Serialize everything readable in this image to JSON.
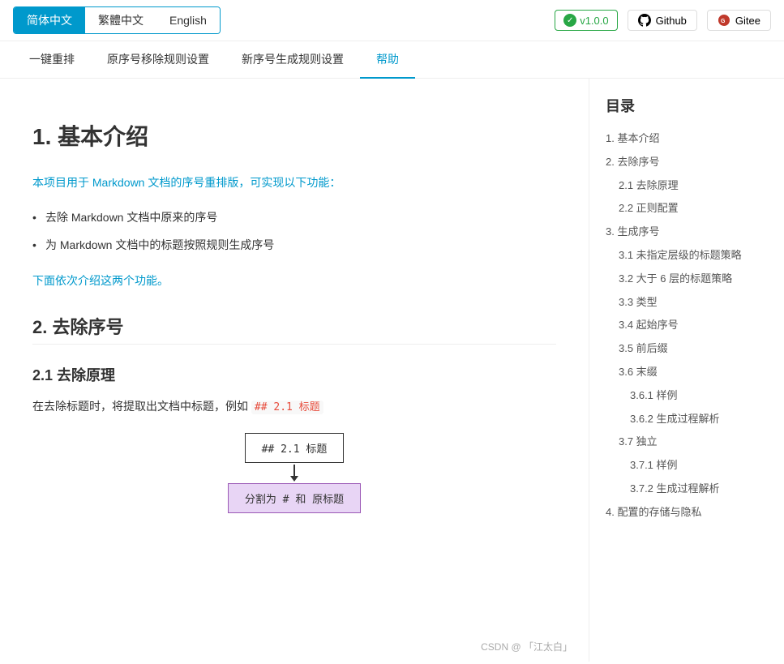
{
  "header": {
    "lang_tabs": [
      {
        "label": "简体中文",
        "active": true
      },
      {
        "label": "繁體中文",
        "active": false
      },
      {
        "label": "English",
        "active": false
      }
    ],
    "version": "v1.0.0",
    "github_label": "Github",
    "gitee_label": "Gitee"
  },
  "nav": {
    "items": [
      {
        "label": "一键重排",
        "active": false
      },
      {
        "label": "原序号移除规则设置",
        "active": false
      },
      {
        "label": "新序号生成规则设置",
        "active": false
      },
      {
        "label": "帮助",
        "active": true
      }
    ]
  },
  "sidebar": {
    "title": "目录",
    "toc": [
      {
        "label": "1. 基本介绍",
        "indent": 0
      },
      {
        "label": "2. 去除序号",
        "indent": 0
      },
      {
        "label": "2.1 去除原理",
        "indent": 1
      },
      {
        "label": "2.2 正则配置",
        "indent": 1
      },
      {
        "label": "3. 生成序号",
        "indent": 0
      },
      {
        "label": "3.1 未指定层级的标题策略",
        "indent": 1
      },
      {
        "label": "3.2 大于 6 层的标题策略",
        "indent": 1
      },
      {
        "label": "3.3 类型",
        "indent": 1
      },
      {
        "label": "3.4 起始序号",
        "indent": 1
      },
      {
        "label": "3.5 前后缀",
        "indent": 1
      },
      {
        "label": "3.6 末缀",
        "indent": 1
      },
      {
        "label": "3.6.1 样例",
        "indent": 2
      },
      {
        "label": "3.6.2 生成过程解析",
        "indent": 2
      },
      {
        "label": "3.7 独立",
        "indent": 1
      },
      {
        "label": "3.7.1 样例",
        "indent": 2
      },
      {
        "label": "3.7.2 生成过程解析",
        "indent": 2
      },
      {
        "label": "4. 配置的存储与隐私",
        "indent": 0
      }
    ]
  },
  "content": {
    "section1_title": "1. 基本介绍",
    "intro_text": "本项目用于 Markdown 文档的序号重排版，可实现以下功能：",
    "bullet1": "去除 Markdown 文档中原来的序号",
    "bullet2": "为 Markdown 文档中的标题按照规则生成序号",
    "follow_text": "下面依次介绍这两个功能。",
    "section2_title": "2. 去除序号",
    "section2_1_title": "2.1 去除原理",
    "desc_text": "在去除标题时，将提取出文档中标题，例如",
    "inline_code": "## 2.1 标题",
    "diagram_box1": "## 2.1 标题",
    "diagram_box2": "分割为 # 和 原标题"
  },
  "watermark": "CSDN @ 「江太白」"
}
